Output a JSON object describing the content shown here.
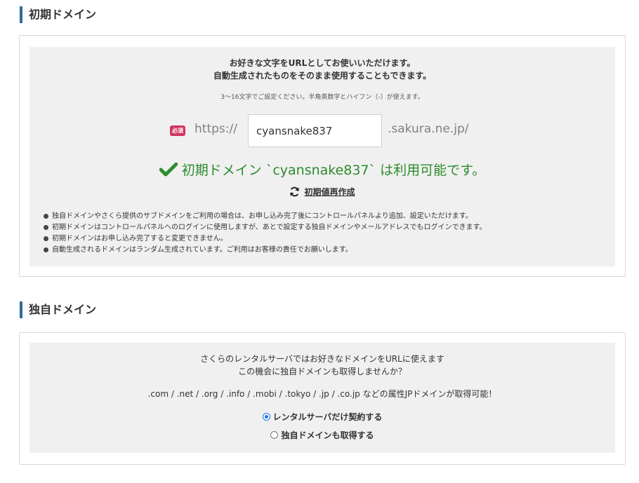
{
  "initial_domain": {
    "heading": "初期ドメイン",
    "intro_line1": "お好きな文字をURLとしてお使いいただけます。",
    "intro_line2": "自動生成されたものをそのまま使用することもできます。",
    "note": "3〜16文字でご設定ください。半角英数字とハイフン（-）が使えます。",
    "required_badge": "必須",
    "protocol": "https://",
    "input_value": "cyansnake837",
    "suffix": ".sakura.ne.jp/",
    "availability_message": "初期ドメイン `cyansnake837` は利用可能です。",
    "regenerate_label": "初期値再作成",
    "bullets": [
      "独自ドメインやさくら提供のサブドメインをご利用の場合は、お申し込み完了後にコントロールパネルより追加、設定いただけます。",
      "初期ドメインはコントロールパネルへのログインに使用しますが、あとで設定する独自ドメインやメールアドレスでもログインできます。",
      "初期ドメインはお申し込み完了すると変更できません。",
      "自動生成されるドメインはランダム生成されています。ご利用はお客様の責任でお願いします。"
    ]
  },
  "own_domain": {
    "heading": "独自ドメイン",
    "line1": "さくらのレンタルサーバではお好きなドメインをURLに使えます",
    "line2": "この機会に独自ドメインも取得しませんか？",
    "line3": ".com / .net / .org / .info / .mobi / .tokyo / .jp / .co.jp などの属性JPドメインが取得可能！",
    "options": [
      {
        "label": "レンタルサーバだけ契約する",
        "selected": true
      },
      {
        "label": "独自ドメインも取得する",
        "selected": false
      }
    ]
  },
  "colors": {
    "accent_bar": "#2d6c97",
    "success": "#2c8c2c",
    "required_badge": "#d0355f",
    "radio_selected": "#1a73e8"
  },
  "icons": {
    "availability": "check-icon",
    "regenerate": "refresh-icon"
  }
}
